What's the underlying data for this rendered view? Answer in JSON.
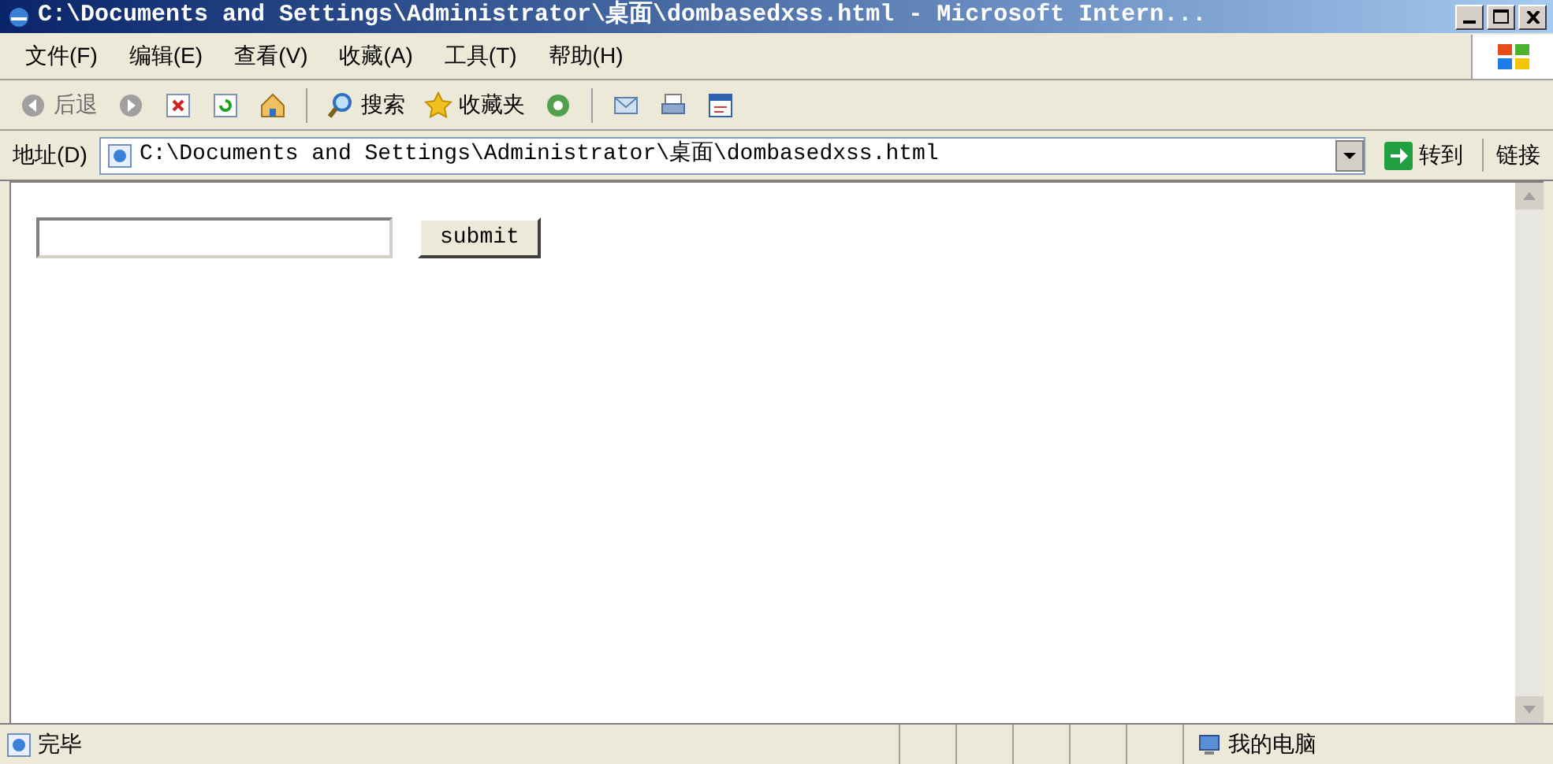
{
  "window": {
    "title": "C:\\Documents and Settings\\Administrator\\桌面\\dombasedxss.html - Microsoft Intern..."
  },
  "menu": [
    {
      "label": "文件(F)"
    },
    {
      "label": "编辑(E)"
    },
    {
      "label": "查看(V)"
    },
    {
      "label": "收藏(A)"
    },
    {
      "label": "工具(T)"
    },
    {
      "label": "帮助(H)"
    }
  ],
  "toolbar": [
    {
      "kind": "back",
      "label": "后退",
      "disabled": true
    },
    {
      "kind": "forward",
      "disabled": true
    },
    {
      "kind": "stop",
      "disabled": false
    },
    {
      "kind": "refresh",
      "disabled": false
    },
    {
      "kind": "home",
      "disabled": false
    },
    {
      "kind": "search",
      "label": "搜索",
      "disabled": false
    },
    {
      "kind": "favorites",
      "label": "收藏夹",
      "disabled": false
    },
    {
      "kind": "media",
      "disabled": false
    },
    {
      "kind": "mail",
      "disabled": false
    },
    {
      "kind": "print",
      "disabled": false
    },
    {
      "kind": "edit",
      "disabled": false
    }
  ],
  "address_bar": {
    "label": "地址(D)",
    "value": "C:\\Documents and Settings\\Administrator\\桌面\\dombasedxss.html",
    "go_button": "转到",
    "links": "链接"
  },
  "page": {
    "submit_button": "submit"
  },
  "status_bar": {
    "text": "完毕",
    "zone": "我的电脑"
  }
}
